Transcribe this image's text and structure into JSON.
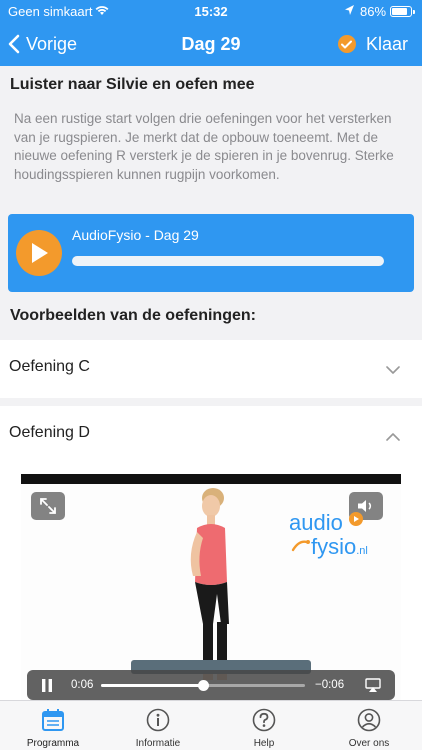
{
  "status_bar": {
    "carrier": "Geen simkaart",
    "time": "15:32",
    "battery": "86%",
    "battery_level": 0.86
  },
  "nav": {
    "back_label": "Vorige",
    "title": "Dag 29",
    "done_label": "Klaar"
  },
  "lesson": {
    "heading": "Luister naar Silvie en oefen mee",
    "intro": "Na een rustige start volgen drie oefeningen voor het versterken van je rugspieren. Je merkt dat de opbouw toeneemt. Met de nieuwe oefening R versterk je de spieren in je bovenrug. Sterke houdingsspieren kunnen rugpijn voorkomen."
  },
  "audio": {
    "title": "AudioFysio - Dag 29",
    "progress": 0.0
  },
  "examples": {
    "heading": "Voorbeelden van de oefeningen:",
    "items": [
      {
        "label": "Oefening C",
        "expanded": false
      },
      {
        "label": "Oefening D",
        "expanded": true
      }
    ]
  },
  "video": {
    "logo_line1": "audio",
    "logo_line2": "fysio",
    "logo_suffix": ".nl",
    "current_time": "0:06",
    "remaining_time": "−0:06",
    "progress": 0.5
  },
  "tabs": [
    {
      "label": "Programma",
      "icon": "calendar-icon",
      "active": true
    },
    {
      "label": "Informatie",
      "icon": "info-icon",
      "active": false
    },
    {
      "label": "Help",
      "icon": "help-icon",
      "active": false
    },
    {
      "label": "Over ons",
      "icon": "person-icon",
      "active": false
    }
  ],
  "colors": {
    "accent": "#2f97f1",
    "orange": "#f39a2c",
    "tab_active": "#2f97f1"
  }
}
